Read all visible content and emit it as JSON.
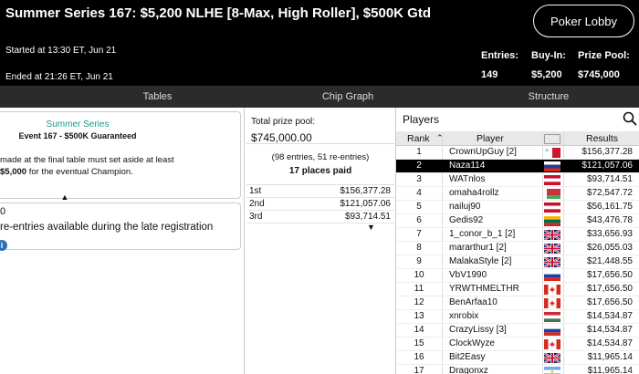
{
  "header": {
    "title": "Summer Series 167: $5,200 NLHE [8-Max, High Roller], $500K Gtd",
    "lobby_button": "Poker Lobby",
    "started": "Started at 13:30 ET, Jun 21",
    "ended": "Ended at 21:26 ET, Jun 21",
    "stats": {
      "entries_label": "Entries:",
      "entries_value": "149",
      "buyin_label": "Buy-In:",
      "buyin_value": "$5,200",
      "prize_label": "Prize Pool:",
      "prize_value": "$745,000"
    }
  },
  "tabs": [
    "Tables",
    "Chip Graph",
    "Structure"
  ],
  "info": {
    "series": "Summer Series",
    "event": "Event 167 - $500K Guaranteed",
    "desc_line1": "made at the final table must set aside at least",
    "desc_line2": "$5,000",
    "desc_line2_rest": " for the eventual Champion.",
    "reentry_count": "0",
    "reentry_text": "re-entries available during the late registration",
    "info_icon_glyph": "i"
  },
  "prize": {
    "label": "Total prize pool:",
    "value": "$745,000.00",
    "entries_note": "(98 entries, 51 re-entries)",
    "places_note": "17 places paid",
    "payouts": [
      {
        "place": "1st",
        "amount": "$156,377.28"
      },
      {
        "place": "2nd",
        "amount": "$121,057.06"
      },
      {
        "place": "3rd",
        "amount": "$93,714.51"
      }
    ]
  },
  "players": {
    "title": "Players",
    "columns": {
      "rank": "Rank",
      "player": "Player",
      "results": "Results"
    },
    "rows": [
      {
        "rank": "1",
        "name": "CrownUpGuy [2]",
        "flag": "mt",
        "result": "$156,377.28"
      },
      {
        "rank": "2",
        "name": "Naza114",
        "flag": "ru",
        "result": "$121,057.06",
        "selected": true
      },
      {
        "rank": "3",
        "name": "WATnlos",
        "flag": "at",
        "result": "$93,714.51"
      },
      {
        "rank": "4",
        "name": "omaha4rollz",
        "flag": "by",
        "result": "$72,547.72"
      },
      {
        "rank": "5",
        "name": "nailuj90",
        "flag": "at",
        "result": "$56,161.75"
      },
      {
        "rank": "6",
        "name": "Gedis92",
        "flag": "lt",
        "result": "$43,476.78"
      },
      {
        "rank": "7",
        "name": "1_conor_b_1 [2]",
        "flag": "gb",
        "result": "$33,656.93"
      },
      {
        "rank": "8",
        "name": "mararthur1 [2]",
        "flag": "gb",
        "result": "$26,055.03"
      },
      {
        "rank": "9",
        "name": "MalakaStyle [2]",
        "flag": "gb",
        "result": "$21,448.55"
      },
      {
        "rank": "10",
        "name": "VbV1990",
        "flag": "ru",
        "result": "$17,656.50"
      },
      {
        "rank": "11",
        "name": "YRWTHMELTHR",
        "flag": "ca",
        "result": "$17,656.50"
      },
      {
        "rank": "12",
        "name": "BenArfaa10",
        "flag": "ca",
        "result": "$17,656.50"
      },
      {
        "rank": "13",
        "name": "xnrobix",
        "flag": "hu",
        "result": "$14,534.87"
      },
      {
        "rank": "14",
        "name": "CrazyLissy [3]",
        "flag": "ru",
        "result": "$14,534.87"
      },
      {
        "rank": "15",
        "name": "ClockWyze",
        "flag": "ca",
        "result": "$14,534.87"
      },
      {
        "rank": "16",
        "name": "Bit2Easy",
        "flag": "gb",
        "result": "$11,965.14"
      },
      {
        "rank": "17",
        "name": "Dragonxz",
        "flag": "ar",
        "result": "$11,965.14"
      }
    ]
  }
}
